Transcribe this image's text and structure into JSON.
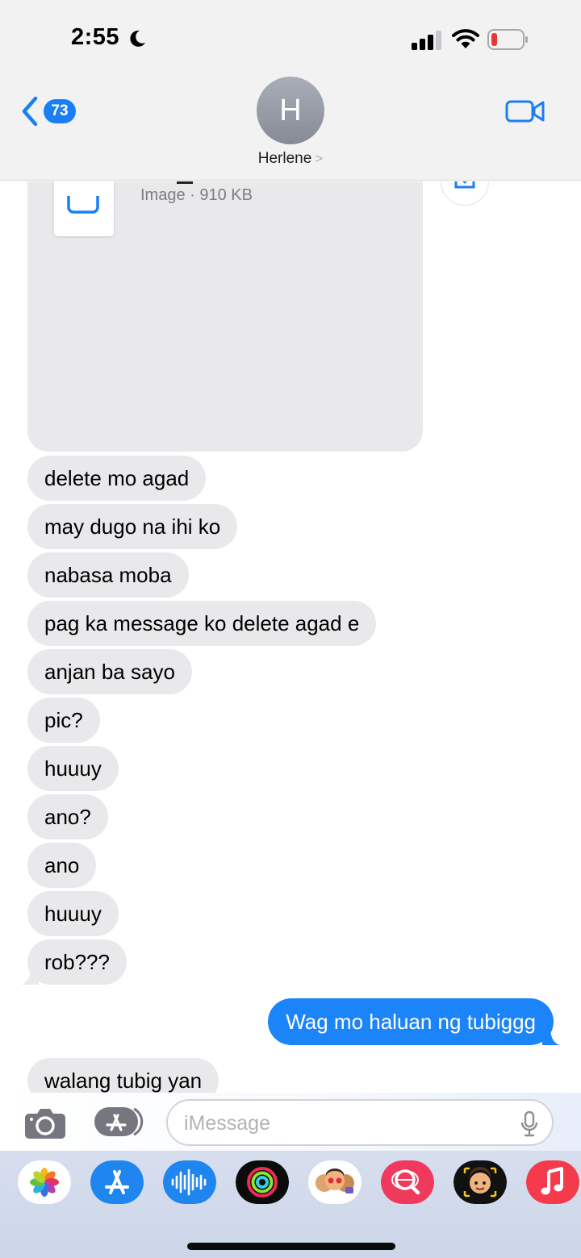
{
  "status_bar": {
    "time": "2:55",
    "icons": [
      "moon-icon",
      "signal-icon",
      "wifi-icon",
      "battery-low-icon"
    ]
  },
  "header": {
    "back_badge": "73",
    "avatar_initial": "H",
    "contact_name": "Herlene",
    "contact_chevron": ">",
    "video_icon": "video-camera-icon"
  },
  "attachment": {
    "meta": "Image · 910 KB",
    "icon": "document-copy-icon",
    "save_icon": "save-download-icon"
  },
  "received_messages": [
    "delete mo agad",
    "may dugo na ihi ko",
    "nabasa moba",
    "pag ka message ko delete agad e",
    "anjan ba sayo",
    "pic?",
    "huuuy",
    "ano?",
    "ano",
    "huuuy",
    "rob???"
  ],
  "sent_message": "Wag mo haluan ng tubiggg",
  "received_last": "walang tubig yan",
  "input_bar": {
    "placeholder": "iMessage",
    "camera_icon": "camera-icon",
    "apps_icon": "app-store-icon",
    "mic_icon": "microphone-icon"
  },
  "app_drawer": [
    "photos-app-icon",
    "app-store-app-icon",
    "audio-message-app-icon",
    "activity-app-icon",
    "memoji-stickers-app-icon",
    "web-search-app-icon",
    "memoji-app-icon",
    "music-app-icon"
  ],
  "colors": {
    "sent_bubble": "#1b84f8",
    "received_bubble": "#e9e9eb",
    "badge": "#1a7ff5",
    "battery_low": "#e53935"
  }
}
